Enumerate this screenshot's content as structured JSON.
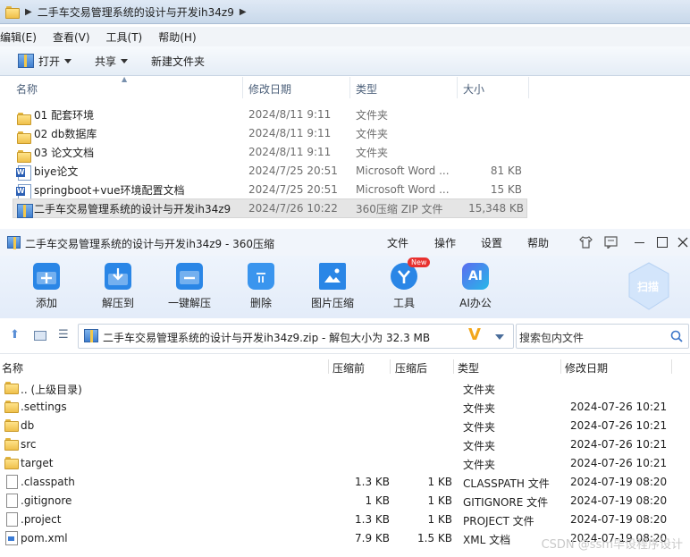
{
  "explorer": {
    "address_path": "二手车交易管理系统的设计与开发ih34z9",
    "menu": [
      "编辑(E)",
      "查看(V)",
      "工具(T)",
      "帮助(H)"
    ],
    "toolbar": {
      "open": "打开",
      "share": "共享",
      "new_folder": "新建文件夹"
    },
    "columns": {
      "name": "名称",
      "date": "修改日期",
      "type": "类型",
      "size": "大小"
    },
    "rows": [
      {
        "name": "01 配套环境",
        "date": "2024/8/11 9:11",
        "type": "文件夹",
        "size": "",
        "icon": "folder-icon"
      },
      {
        "name": "02 db数据库",
        "date": "2024/8/11 9:11",
        "type": "文件夹",
        "size": "",
        "icon": "folder-icon"
      },
      {
        "name": "03 论文文档",
        "date": "2024/8/11 9:11",
        "type": "文件夹",
        "size": "",
        "icon": "folder-icon"
      },
      {
        "name": "biye论文",
        "date": "2024/7/25 20:51",
        "type": "Microsoft Word ...",
        "size": "81 KB",
        "icon": "word-doc-icon"
      },
      {
        "name": "springboot+vue环境配置文档",
        "date": "2024/7/25 20:51",
        "type": "Microsoft Word ...",
        "size": "15 KB",
        "icon": "word-doc-icon"
      },
      {
        "name": "二手车交易管理系统的设计与开发ih34z9",
        "date": "2024/7/26 10:22",
        "type": "360压缩 ZIP 文件",
        "size": "15,348 KB",
        "icon": "zip-archive-icon"
      }
    ]
  },
  "zip_window": {
    "title": "二手车交易管理系统的设计与开发ih34z9 - 360压缩",
    "title_menu": [
      "文件",
      "操作",
      "设置",
      "帮助"
    ],
    "ribbon": [
      {
        "label": "添加",
        "icon": "add-icon"
      },
      {
        "label": "解压到",
        "icon": "extract-to-icon"
      },
      {
        "label": "一键解压",
        "icon": "one-click-extract-icon"
      },
      {
        "label": "删除",
        "icon": "delete-icon"
      },
      {
        "label": "图片压缩",
        "icon": "image-compress-icon"
      },
      {
        "label": "工具",
        "icon": "tools-icon",
        "badge": "New"
      },
      {
        "label": "AI办公",
        "icon": "ai-office-icon"
      }
    ],
    "scan_label": "扫描",
    "ai_glyph": "AI",
    "address_text": "二手车交易管理系统的设计与开发ih34z9.zip - 解包大小为 32.3 MB",
    "search_placeholder": "搜索包内文件",
    "columns": {
      "name": "名称",
      "packed": "压缩前",
      "compressed": "压缩后",
      "type": "类型",
      "date": "修改日期"
    },
    "rows": [
      {
        "name": ".. (上级目录)",
        "packed": "",
        "compressed": "",
        "type": "文件夹",
        "date": "",
        "icon": "folder-icon"
      },
      {
        "name": ".settings",
        "packed": "",
        "compressed": "",
        "type": "文件夹",
        "date": "2024-07-26 10:21",
        "icon": "folder-icon"
      },
      {
        "name": "db",
        "packed": "",
        "compressed": "",
        "type": "文件夹",
        "date": "2024-07-26 10:21",
        "icon": "folder-icon"
      },
      {
        "name": "src",
        "packed": "",
        "compressed": "",
        "type": "文件夹",
        "date": "2024-07-26 10:21",
        "icon": "folder-icon"
      },
      {
        "name": "target",
        "packed": "",
        "compressed": "",
        "type": "文件夹",
        "date": "2024-07-26 10:21",
        "icon": "folder-icon"
      },
      {
        "name": ".classpath",
        "packed": "1.3 KB",
        "compressed": "1 KB",
        "type": "CLASSPATH 文件",
        "date": "2024-07-19 08:20",
        "icon": "file-icon"
      },
      {
        "name": ".gitignore",
        "packed": "1 KB",
        "compressed": "1 KB",
        "type": "GITIGNORE 文件",
        "date": "2024-07-19 08:20",
        "icon": "file-icon"
      },
      {
        "name": ".project",
        "packed": "1.3 KB",
        "compressed": "1 KB",
        "type": "PROJECT 文件",
        "date": "2024-07-19 08:20",
        "icon": "file-icon"
      },
      {
        "name": "pom.xml",
        "packed": "7.9 KB",
        "compressed": "1.5 KB",
        "type": "XML 文档",
        "date": "2024-07-19 08:20",
        "icon": "xml-file-icon"
      }
    ]
  },
  "watermark": "CSDN @ssm毕设程序设计"
}
